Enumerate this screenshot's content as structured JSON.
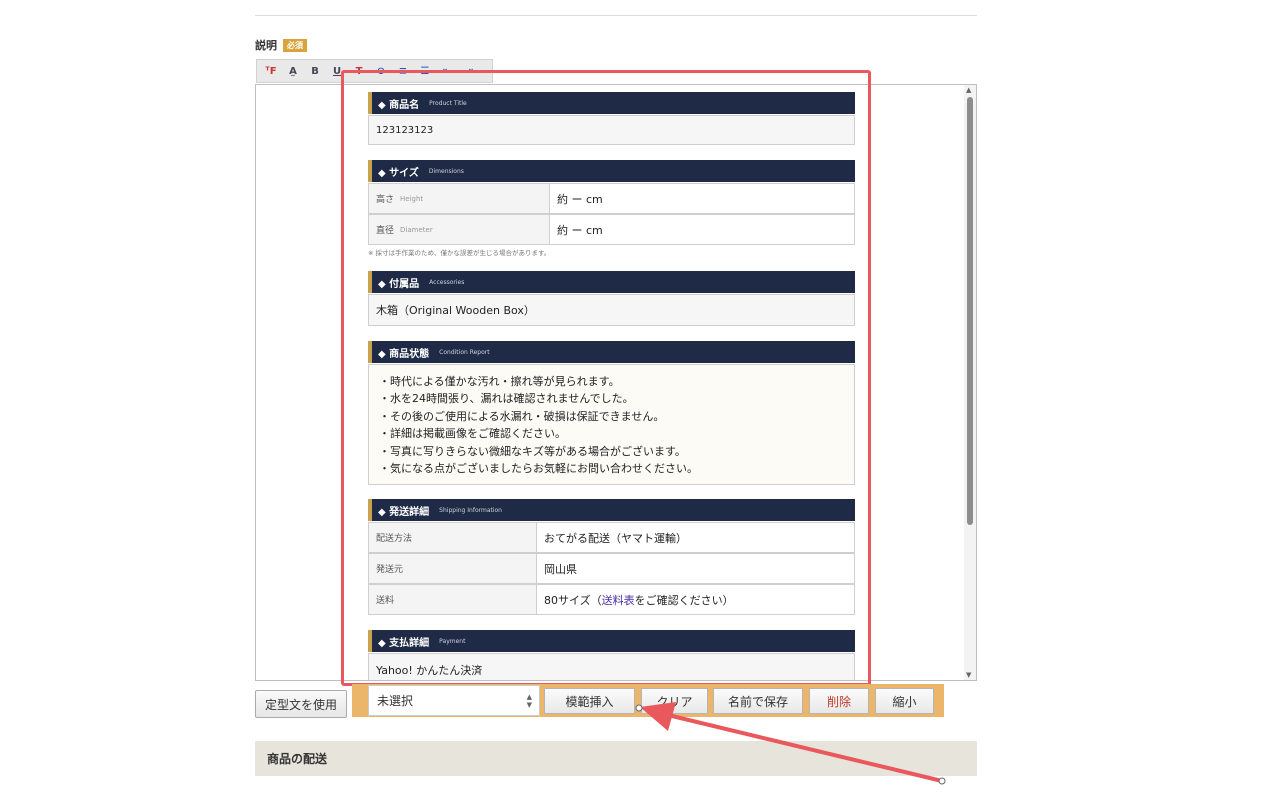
{
  "description": {
    "label": "説明",
    "required_badge": "必須"
  },
  "toolbar": {
    "buttons": [
      {
        "name": "font-icon",
        "glyph": "ᵀF"
      },
      {
        "name": "text-color-icon",
        "glyph": "A̰"
      },
      {
        "name": "bold-icon",
        "glyph": "B"
      },
      {
        "name": "underline-icon",
        "glyph": "U"
      },
      {
        "name": "text-highlight-icon",
        "glyph": "T"
      },
      {
        "name": "link-icon",
        "glyph": "⊖"
      },
      {
        "name": "align-icon",
        "glyph": "≡"
      },
      {
        "name": "list-icon",
        "glyph": "☰"
      },
      {
        "name": "indent-icon",
        "glyph": "⇤"
      },
      {
        "name": "outdent-icon",
        "glyph": "⇥"
      }
    ]
  },
  "editor": {
    "product": {
      "title": "◆ 商品名",
      "sub": "Product Title",
      "value": "123123123"
    },
    "size": {
      "title": "◆ サイズ",
      "sub": "Dimensions",
      "rows": [
        {
          "label": "高さ",
          "label_en": "Height",
          "value": "約 ー cm"
        },
        {
          "label": "直径",
          "label_en": "Diameter",
          "value": "約 ー cm"
        }
      ],
      "note": "※ 採寸は手作業のため、僅かな誤差が生じる場合があります。"
    },
    "accessories": {
      "title": "◆ 付属品",
      "sub": "Accessories",
      "value": "木箱（Original Wooden Box）"
    },
    "condition": {
      "title": "◆ 商品状態",
      "sub": "Condition Report",
      "lines": [
        "・時代による僅かな汚れ・擦れ等が見られます。",
        "・水を24時間張り、漏れは確認されませんでした。",
        "・その後のご使用による水漏れ・破損は保証できません。",
        "・詳細は掲載画像をご確認ください。",
        "・写真に写りきらない微細なキズ等がある場合がございます。",
        "・気になる点がございましたらお気軽にお問い合わせください。"
      ]
    },
    "shipping": {
      "title": "◆ 発送詳細",
      "sub": "Shipping Information",
      "rows": [
        {
          "label": "配送方法",
          "value": "おてがる配送（ヤマト運輸）"
        },
        {
          "label": "発送元",
          "value": "岡山県"
        }
      ],
      "fee_label": "送料",
      "fee_prefix": "80サイズ（",
      "fee_link": "送料表",
      "fee_suffix": "をご確認ください）"
    },
    "payment": {
      "title": "◆ 支払詳細",
      "sub": "Payment",
      "value": "Yahoo! かんたん決済"
    }
  },
  "controls": {
    "use_template": "定型文を使用",
    "select_value": "未選択",
    "insert_example": "模範挿入",
    "clear": "クリア",
    "save_as": "名前で保存",
    "delete": "削除",
    "shrink": "縮小"
  },
  "next_section": {
    "title": "商品の配送"
  },
  "colors": {
    "header_bg": "#1f2a46",
    "header_accent": "#c9a24d",
    "highlight_red": "#e8585c",
    "control_bar": "#ebb66a"
  }
}
